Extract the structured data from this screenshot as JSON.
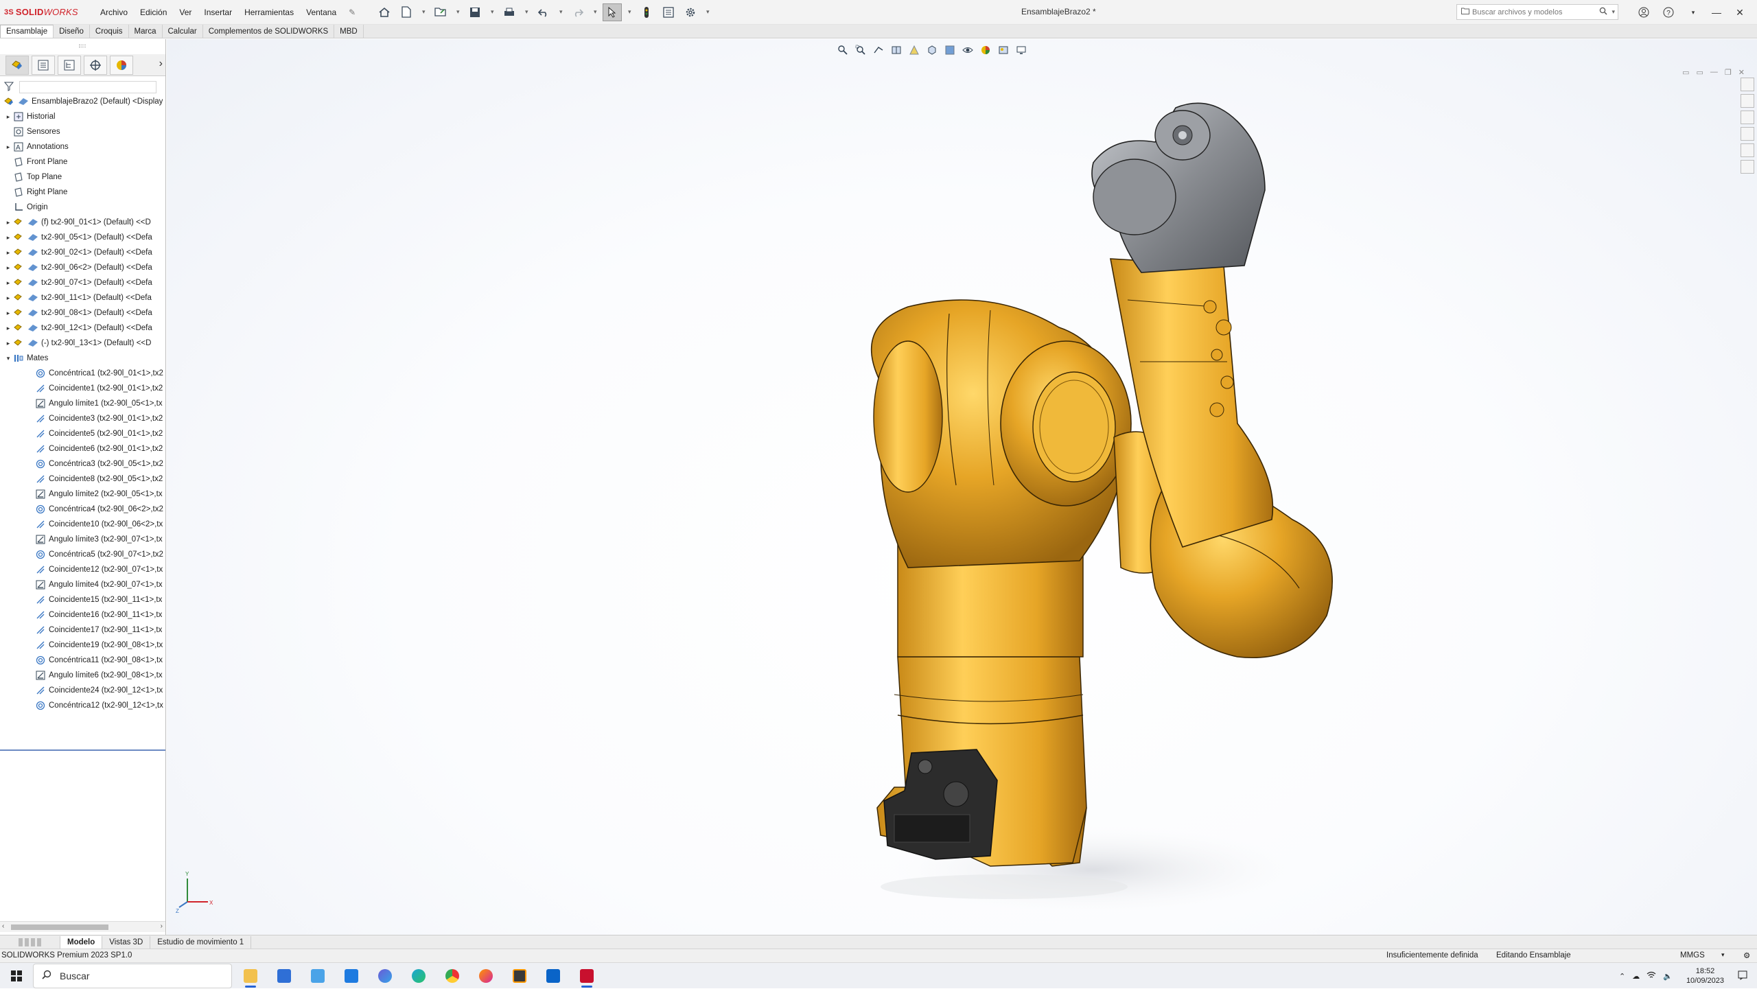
{
  "app": {
    "logo_ds": "3S",
    "logo_solid": "SOLID",
    "logo_works": "WORKS",
    "document_title": "EnsamblajeBrazo2 *",
    "menu": [
      "Archivo",
      "Edición",
      "Ver",
      "Insertar",
      "Herramientas",
      "Ventana"
    ],
    "search_placeholder": "Buscar archivos y modelos"
  },
  "command_tabs": [
    "Ensamblaje",
    "Diseño",
    "Croquis",
    "Marca",
    "Calcular",
    "Complementos de SOLIDWORKS",
    "MBD"
  ],
  "tree": {
    "root": "EnsamblajeBrazo2 (Default) <Display",
    "features": [
      "Historial",
      "Sensores",
      "Annotations",
      "Front Plane",
      "Top Plane",
      "Right Plane",
      "Origin"
    ],
    "components": [
      "(f) tx2-90l_01<1> (Default) <<D",
      "tx2-90l_05<1> (Default) <<Defa",
      "tx2-90l_02<1> (Default) <<Defa",
      "tx2-90l_06<2> (Default) <<Defa",
      "tx2-90l_07<1> (Default) <<Defa",
      "tx2-90l_11<1> (Default) <<Defa",
      "tx2-90l_08<1> (Default) <<Defa",
      "tx2-90l_12<1> (Default) <<Defa",
      "(-) tx2-90l_13<1> (Default) <<D"
    ],
    "mates_folder": "Mates",
    "mates": [
      {
        "type": "concentric",
        "label": "Concéntrica1 (tx2-90l_01<1>,tx2"
      },
      {
        "type": "coincident",
        "label": "Coincidente1 (tx2-90l_01<1>,tx2"
      },
      {
        "type": "angle",
        "label": "Ángulo límite1 (tx2-90l_05<1>,tx"
      },
      {
        "type": "coincident",
        "label": "Coincidente3 (tx2-90l_01<1>,tx2"
      },
      {
        "type": "coincident",
        "label": "Coincidente5 (tx2-90l_01<1>,tx2"
      },
      {
        "type": "coincident",
        "label": "Coincidente6 (tx2-90l_01<1>,tx2"
      },
      {
        "type": "concentric",
        "label": "Concéntrica3 (tx2-90l_05<1>,tx2"
      },
      {
        "type": "coincident",
        "label": "Coincidente8 (tx2-90l_05<1>,tx2"
      },
      {
        "type": "angle",
        "label": "Ángulo límite2 (tx2-90l_05<1>,tx"
      },
      {
        "type": "concentric",
        "label": "Concéntrica4 (tx2-90l_06<2>,tx2"
      },
      {
        "type": "coincident",
        "label": "Coincidente10 (tx2-90l_06<2>,tx"
      },
      {
        "type": "angle",
        "label": "Ángulo límite3 (tx2-90l_07<1>,tx"
      },
      {
        "type": "concentric",
        "label": "Concéntrica5 (tx2-90l_07<1>,tx2"
      },
      {
        "type": "coincident",
        "label": "Coincidente12 (tx2-90l_07<1>,tx"
      },
      {
        "type": "angle",
        "label": "Ángulo límite4 (tx2-90l_07<1>,tx"
      },
      {
        "type": "coincident",
        "label": "Coincidente15 (tx2-90l_11<1>,tx"
      },
      {
        "type": "coincident",
        "label": "Coincidente16 (tx2-90l_11<1>,tx"
      },
      {
        "type": "coincident",
        "label": "Coincidente17 (tx2-90l_11<1>,tx"
      },
      {
        "type": "coincident",
        "label": "Coincidente19 (tx2-90l_08<1>,tx"
      },
      {
        "type": "concentric",
        "label": "Concéntrica11 (tx2-90l_08<1>,tx"
      },
      {
        "type": "angle",
        "label": "Ángulo límite6 (tx2-90l_08<1>,tx"
      },
      {
        "type": "coincident",
        "label": "Coincidente24 (tx2-90l_12<1>,tx"
      },
      {
        "type": "concentric",
        "label": "Concéntrica12 (tx2-90l_12<1>,tx"
      }
    ]
  },
  "triad": {
    "x": "X",
    "y": "Y",
    "z": "Z"
  },
  "bottom_tabs": [
    "Modelo",
    "Vistas 3D",
    "Estudio de movimiento 1"
  ],
  "status": {
    "version": "SOLIDWORKS Premium 2023 SP1.0",
    "definition": "Insuficientemente definida",
    "mode": "Editando Ensamblaje",
    "units": "MMGS"
  },
  "taskbar": {
    "search_label": "Buscar",
    "time": "18:52",
    "date": "10/09/2023"
  },
  "colors": {
    "robot_body": "#e6a526",
    "robot_dark": "#6e4a08",
    "wrist_gray": "#8a8d92",
    "base_black": "#2c2c2c",
    "brand_red": "#d0232b"
  }
}
